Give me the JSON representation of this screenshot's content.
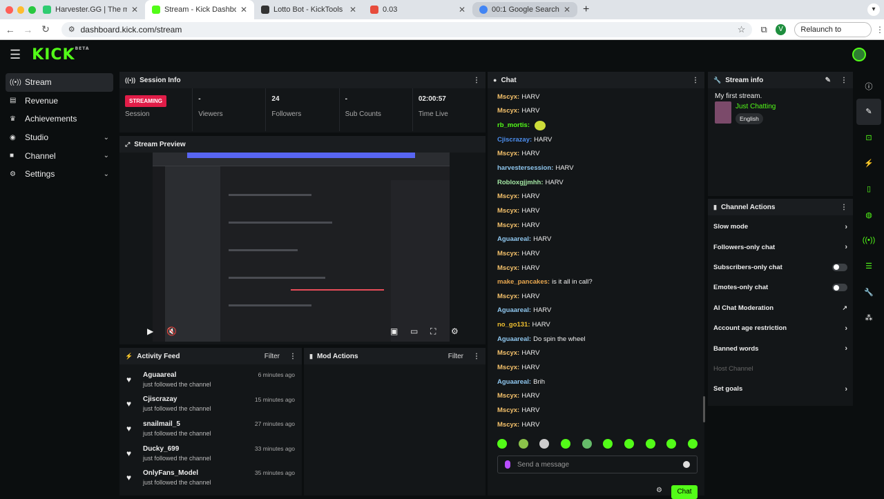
{
  "browser": {
    "tabs": [
      {
        "label": "Harvester.GG | The most inno",
        "color": "#2ecc71"
      },
      {
        "label": "Stream - Kick Dashboard",
        "color": "#53fc18"
      },
      {
        "label": "Lotto Bot - KickTools",
        "color": "#333333"
      },
      {
        "label": "0.03",
        "color": "#e74c3c"
      },
      {
        "label": "00:1 Google Search",
        "color": "#4285f4"
      }
    ],
    "url": "dashboard.kick.com/stream",
    "profile_initial": "V",
    "relaunch_label": "Relaunch to update"
  },
  "brand": {
    "logo": "KICK",
    "beta": "BETA",
    "accent": "#53fc18"
  },
  "sidebar": {
    "items": [
      {
        "label": "Stream",
        "icon": "broadcast-icon"
      },
      {
        "label": "Revenue",
        "icon": "revenue-icon"
      },
      {
        "label": "Achievements",
        "icon": "trophy-icon"
      },
      {
        "label": "Studio",
        "icon": "studio-icon"
      },
      {
        "label": "Channel",
        "icon": "channel-icon"
      },
      {
        "label": "Settings",
        "icon": "gear-icon"
      }
    ]
  },
  "session": {
    "title": "Session Info",
    "status": "STREAMING",
    "status_label": "Session",
    "viewers_value": "-",
    "viewers_label": "Viewers",
    "followers_value": "24",
    "followers_label": "Followers",
    "subs_value": "-",
    "subs_label": "Sub Counts",
    "time_value": "02:00:57",
    "time_label": "Time Live"
  },
  "preview": {
    "title": "Stream Preview"
  },
  "activity": {
    "title": "Activity Feed",
    "filter": "Filter",
    "items": [
      {
        "name": "Aguaareal",
        "action": "just followed the channel",
        "time": "6 minutes ago"
      },
      {
        "name": "Cjiscrazay",
        "action": "just followed the channel",
        "time": "15 minutes ago"
      },
      {
        "name": "snailmail_5",
        "action": "just followed the channel",
        "time": "27 minutes ago"
      },
      {
        "name": "Ducky_699",
        "action": "just followed the channel",
        "time": "33 minutes ago"
      },
      {
        "name": "OnlyFans_Model",
        "action": "just followed the channel",
        "time": "35 minutes ago"
      }
    ]
  },
  "mod": {
    "title": "Mod Actions",
    "filter": "Filter"
  },
  "chat": {
    "title": "Chat",
    "messages": [
      {
        "user": "Mscyx:",
        "text": "HARV",
        "color": "#f5c26b"
      },
      {
        "user": "Mscyx:",
        "text": "HARV",
        "color": "#f5c26b"
      },
      {
        "user": "rb_mortis:",
        "text": "",
        "color": "#53fc18"
      },
      {
        "user": "Cjiscrazay:",
        "text": "HARV",
        "color": "#4d8ff0"
      },
      {
        "user": "Mscyx:",
        "text": "HARV",
        "color": "#f5c26b"
      },
      {
        "user": "harvestersession:",
        "text": "HARV",
        "color": "#8fc7ef"
      },
      {
        "user": "Robloxgjjmhh:",
        "text": "HARV",
        "color": "#a3e6a3"
      },
      {
        "user": "Mscyx:",
        "text": "HARV",
        "color": "#f5c26b"
      },
      {
        "user": "Mscyx:",
        "text": "HARV",
        "color": "#f5c26b"
      },
      {
        "user": "Mscyx:",
        "text": "HARV",
        "color": "#f5c26b"
      },
      {
        "user": "Aguaareal:",
        "text": "HARV",
        "color": "#8fc7ef"
      },
      {
        "user": "Mscyx:",
        "text": "HARV",
        "color": "#f5c26b"
      },
      {
        "user": "Mscyx:",
        "text": "HARV",
        "color": "#f5c26b"
      },
      {
        "user": "make_pancakes:",
        "text": "is it all in call?",
        "color": "#e8a74f"
      },
      {
        "user": "Mscyx:",
        "text": "HARV",
        "color": "#f5c26b"
      },
      {
        "user": "Aguaareal:",
        "text": "HARV",
        "color": "#8fc7ef"
      },
      {
        "user": "no_go131:",
        "text": "HARV",
        "color": "#f0c030"
      },
      {
        "user": "Aguaareal:",
        "text": "Do spin the wheel",
        "color": "#8fc7ef"
      },
      {
        "user": "Mscyx:",
        "text": "HARV",
        "color": "#f5c26b"
      },
      {
        "user": "Mscyx:",
        "text": "HARV",
        "color": "#f5c26b"
      },
      {
        "user": "Aguaareal:",
        "text": "Brih",
        "color": "#8fc7ef"
      },
      {
        "user": "Mscyx:",
        "text": "HARV",
        "color": "#f5c26b"
      },
      {
        "user": "Mscyx:",
        "text": "HARV",
        "color": "#f5c26b"
      },
      {
        "user": "Mscyx:",
        "text": "HARV",
        "color": "#f5c26b"
      }
    ],
    "placeholder": "Send a message",
    "send_label": "Chat"
  },
  "stream_info": {
    "title": "Stream info",
    "stream_title": "My first stream.",
    "category": "Just Chatting",
    "language": "English"
  },
  "actions": {
    "title": "Channel Actions",
    "items": [
      {
        "label": "Slow mode",
        "kind": "arrow"
      },
      {
        "label": "Followers-only chat",
        "kind": "arrow"
      },
      {
        "label": "Subscribers-only chat",
        "kind": "toggle"
      },
      {
        "label": "Emotes-only chat",
        "kind": "toggle"
      },
      {
        "label": "AI Chat Moderation",
        "kind": "external"
      },
      {
        "label": "Account age restriction",
        "kind": "arrow"
      },
      {
        "label": "Banned words",
        "kind": "arrow"
      },
      {
        "label": "Host Channel",
        "kind": "disabled"
      },
      {
        "label": "Set goals",
        "kind": "arrow"
      }
    ]
  }
}
